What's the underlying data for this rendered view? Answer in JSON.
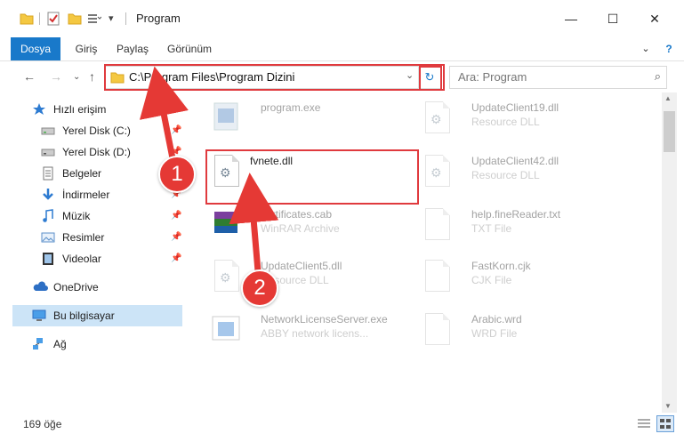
{
  "window": {
    "title": "Program",
    "minimize": "—",
    "maximize": "☐",
    "close": "✕",
    "help": "?",
    "collapse": "⌄"
  },
  "ribbon": {
    "tabs": [
      "Dosya",
      "Giriş",
      "Paylaş",
      "Görünüm"
    ]
  },
  "address": {
    "path": "C:\\Program Files\\Program Dizini",
    "search_placeholder": "Ara: Program"
  },
  "sidebar": {
    "items": [
      {
        "label": "Hızlı erişim",
        "icon": "star-icon"
      },
      {
        "label": "Yerel Disk (C:)",
        "icon": "drive-icon"
      },
      {
        "label": "Yerel Disk (D:)",
        "icon": "drive-icon"
      },
      {
        "label": "Belgeler",
        "icon": "documents-icon"
      },
      {
        "label": "İndirmeler",
        "icon": "download-icon"
      },
      {
        "label": "Müzik",
        "icon": "music-icon"
      },
      {
        "label": "Resimler",
        "icon": "pictures-icon"
      },
      {
        "label": "Videolar",
        "icon": "video-icon"
      },
      {
        "label": "OneDrive",
        "icon": "cloud-icon"
      },
      {
        "label": "Bu bilgisayar",
        "icon": "computer-icon"
      },
      {
        "label": "Ağ",
        "icon": "network-icon"
      }
    ]
  },
  "files": [
    {
      "name": "program.exe",
      "type": ""
    },
    {
      "name": "UpdateClient19.dll",
      "type": "Resource DLL"
    },
    {
      "name": "fvnete.dll",
      "type": ""
    },
    {
      "name": "UpdateClient42.dll",
      "type": "Resource DLL"
    },
    {
      "name": "certificates.cab",
      "type": "WinRAR Archive"
    },
    {
      "name": "help.fineReader.txt",
      "type": "TXT File"
    },
    {
      "name": "UpdateClient5.dll",
      "type": "Resource DLL"
    },
    {
      "name": "FastKorn.cjk",
      "type": "CJK File"
    },
    {
      "name": "NetworkLicenseServer.exe",
      "type": "ABBY network licens..."
    },
    {
      "name": "Arabic.wrd",
      "type": "WRD File"
    }
  ],
  "status": {
    "count": "169 öğe"
  },
  "annotations": {
    "step1": "1",
    "step2": "2"
  },
  "colors": {
    "accent": "#1979ca",
    "annotation": "#e53935"
  }
}
